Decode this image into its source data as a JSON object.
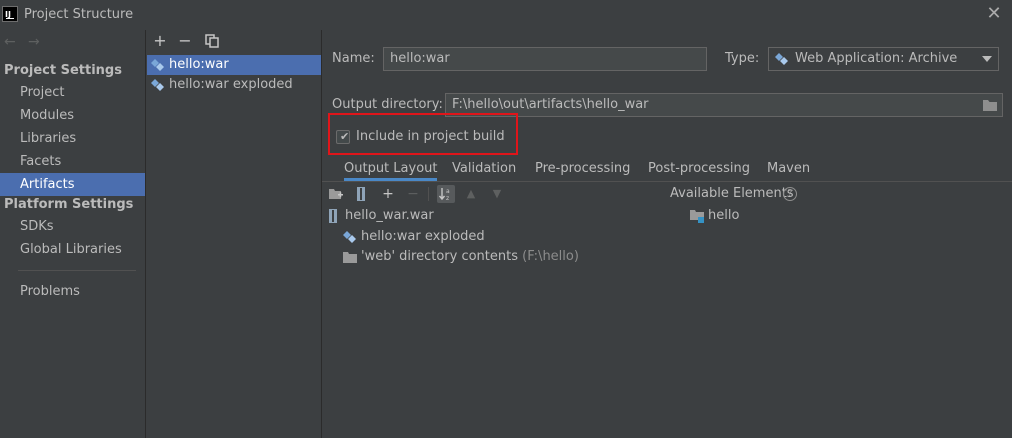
{
  "window": {
    "title": "Project Structure",
    "logo": "IJ"
  },
  "nav": {
    "back_arrow": "←",
    "forward_arrow": "→",
    "project_settings_header": "Project Settings",
    "project_items": [
      "Project",
      "Modules",
      "Libraries",
      "Facets",
      "Artifacts"
    ],
    "platform_settings_header": "Platform Settings",
    "platform_items": [
      "SDKs",
      "Global Libraries"
    ],
    "problems": "Problems",
    "selected": "Artifacts"
  },
  "artifacts": {
    "toolbar": {
      "add": "+",
      "remove": "−"
    },
    "items": [
      "hello:war",
      "hello:war exploded"
    ],
    "selected": "hello:war"
  },
  "form": {
    "name_label": "Name:",
    "name_value": "hello:war",
    "type_label": "Type:",
    "type_value": "Web Application: Archive",
    "output_dir_label": "Output directory:",
    "output_dir_value": "F:\\hello\\out\\artifacts\\hello_war",
    "include_build_label": "Include in project build",
    "include_build_checked": true
  },
  "tabs": [
    "Output Layout",
    "Validation",
    "Pre-processing",
    "Post-processing",
    "Maven"
  ],
  "active_tab": "Output Layout",
  "layout_toolbar": {
    "add": "+",
    "remove": "−",
    "up": "▲",
    "down": "▼"
  },
  "output_tree": {
    "root": "hello_war.war",
    "children": [
      {
        "label": "hello:war exploded",
        "suffix": ""
      },
      {
        "label": "'web' directory contents",
        "suffix": "(F:\\hello)"
      }
    ]
  },
  "available_elements": {
    "label": "Available Elements",
    "help": "?",
    "items": [
      "hello"
    ]
  },
  "colors": {
    "background": "#3c3f41",
    "selection": "#4b6eaf",
    "highlight_border": "#e0151a",
    "active_tab_underline": "#4a88c7"
  }
}
